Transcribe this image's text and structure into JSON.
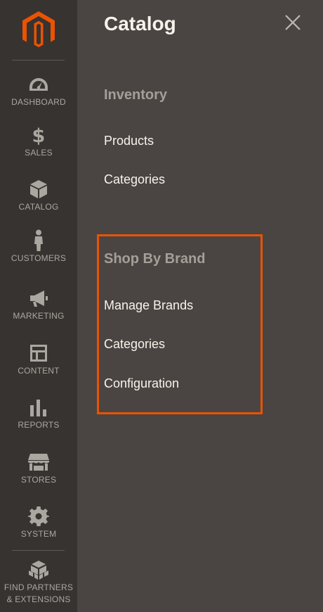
{
  "sidebar": {
    "items": [
      {
        "label": "DASHBOARD",
        "icon": "dashboard-icon"
      },
      {
        "label": "SALES",
        "icon": "dollar-icon"
      },
      {
        "label": "CATALOG",
        "icon": "cube-icon"
      },
      {
        "label": "CUSTOMERS",
        "icon": "person-icon"
      },
      {
        "label": "MARKETING",
        "icon": "megaphone-icon"
      },
      {
        "label": "CONTENT",
        "icon": "layout-icon"
      },
      {
        "label": "REPORTS",
        "icon": "bar-chart-icon"
      },
      {
        "label": "STORES",
        "icon": "storefront-icon"
      },
      {
        "label": "SYSTEM",
        "icon": "gear-icon"
      }
    ],
    "partners": {
      "line1": "FIND PARTNERS",
      "line2": "& EXTENSIONS",
      "icon": "blocks-icon"
    }
  },
  "panel": {
    "title": "Catalog",
    "sections": [
      {
        "title": "Inventory",
        "links": [
          "Products",
          "Categories"
        ]
      },
      {
        "title": "Shop By Brand",
        "links": [
          "Manage Brands",
          "Categories",
          "Configuration"
        ]
      }
    ]
  },
  "colors": {
    "sidebar_bg": "#373330",
    "panel_bg": "#4a4542",
    "logo_orange": "#eb5202",
    "highlight_border": "#eb5202",
    "text_light": "#f7f3eb",
    "section_title": "#a59f98"
  }
}
